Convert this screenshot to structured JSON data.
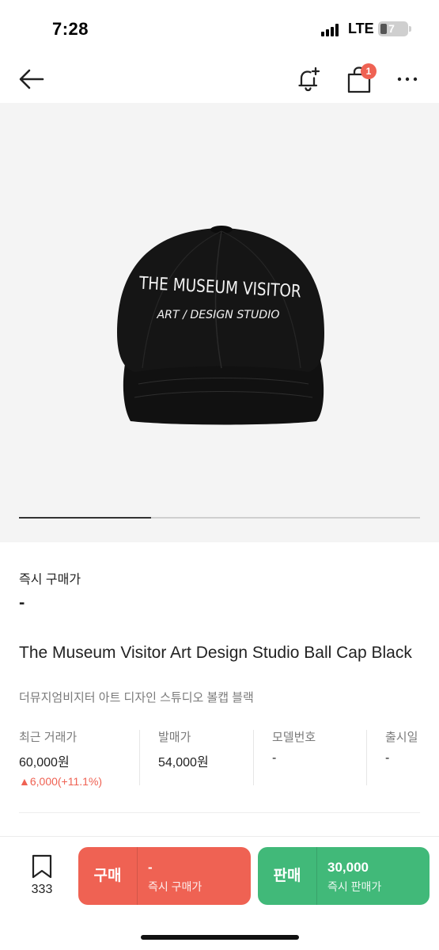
{
  "status_bar": {
    "time": "7:28",
    "network": "LTE",
    "battery": "7"
  },
  "nav": {
    "cart_badge": "1"
  },
  "product": {
    "carousel_progress": 0.33,
    "instant_price_label": "즉시 구매가",
    "instant_price_value": "-",
    "title_en": "The Museum Visitor Art Design Studio Ball Cap Black",
    "title_ko": "더뮤지엄비지터 아트 디자인 스튜디오 볼캡 블랙",
    "image_text": {
      "line1": "THE MUSEUM VISITOR",
      "line2": "ART / DESIGN STUDIO"
    }
  },
  "info": [
    {
      "label": "최근 거래가",
      "value": "60,000원",
      "change": "▲6,000(+11.1%)"
    },
    {
      "label": "발매가",
      "value": "54,000원"
    },
    {
      "label": "모델번호",
      "value": "-"
    },
    {
      "label": "출시일",
      "value": "-"
    }
  ],
  "bottom": {
    "wish_count": "333",
    "buy": {
      "label": "구매",
      "price": "-",
      "sub": "즉시 구매가"
    },
    "sell": {
      "label": "판매",
      "price": "30,000",
      "sub": "즉시 판매가"
    }
  },
  "colors": {
    "buy": "#ef6253",
    "sell": "#41b979",
    "rise": "#ef6253"
  },
  "icons": [
    "back-arrow-icon",
    "bell-plus-icon",
    "shopping-bag-icon",
    "more-icon",
    "bookmark-icon"
  ]
}
